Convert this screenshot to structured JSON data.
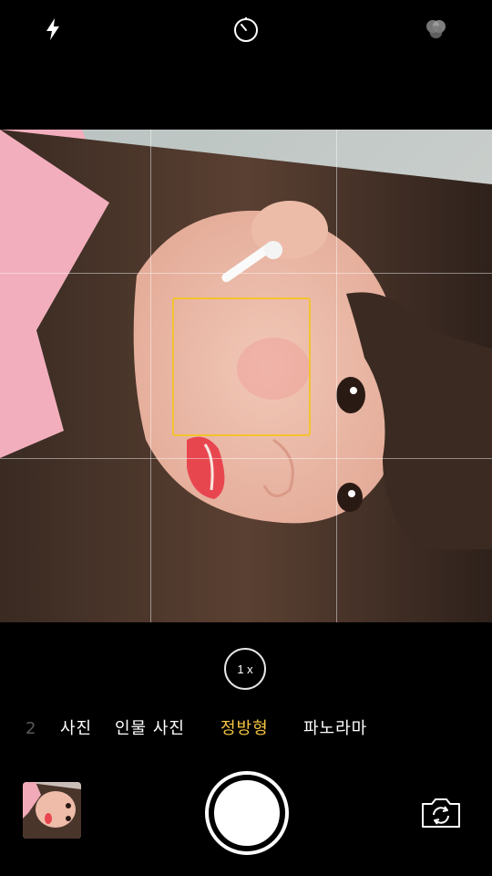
{
  "top_bar": {
    "flash_icon": "flash-icon",
    "timer_icon": "timer-icon",
    "filters_icon": "filters-icon"
  },
  "viewfinder": {
    "grid": true,
    "focus_box_color": "#f2c330"
  },
  "zoom": {
    "label": "1 x"
  },
  "modes": {
    "items": [
      {
        "label": "2",
        "state": "dim"
      },
      {
        "label": "사진",
        "state": "normal"
      },
      {
        "label": "인물 사진",
        "state": "normal"
      },
      {
        "label": "정방형",
        "state": "active"
      },
      {
        "label": "파노라마",
        "state": "normal"
      }
    ],
    "active_color": "#f5c542"
  },
  "bottom": {
    "thumbnail": "last-photo-thumbnail",
    "shutter": "shutter-button",
    "switch_icon": "switch-camera-icon"
  }
}
